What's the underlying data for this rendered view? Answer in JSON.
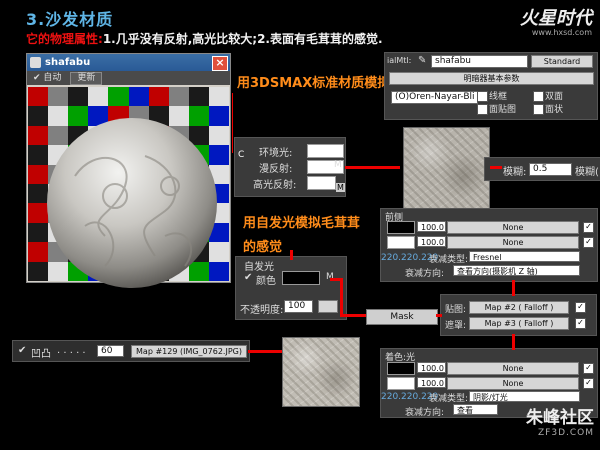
{
  "header": {
    "title": "3.沙发材质",
    "subtitle_red": "它的物理属性:",
    "subtitle_white": "1.几乎没有反射,高光比较大;2.表面有毛茸茸的感觉.",
    "brand": "火星时代",
    "brand_url": "www.hxsd.com"
  },
  "viewer": {
    "title": "shafabu",
    "auto_label": "自动",
    "update_label": "更新",
    "checker_colors": [
      "#c00000",
      "#0018c0",
      "#00a000",
      "#e0e0e0",
      "#1a1a1a",
      "#808080"
    ]
  },
  "notes": {
    "standard_note": "用3DSMAX标准材质模拟:",
    "fuzz_note_1": "用自发光模拟毛茸茸",
    "fuzz_note_2": "的感觉"
  },
  "material_header": {
    "label": "ialMtl:",
    "name": "shafabu",
    "type": "Standard",
    "rollout": "明暗器基本参数",
    "shader": "(O)Oren-Nayar-Bli",
    "opts": [
      "线框",
      "双面",
      "面贴图",
      "面状"
    ]
  },
  "color_panel": {
    "ambient": "环境光:",
    "diffuse": "漫反射:",
    "specular": "高光反射:",
    "lock": "C",
    "m": "M"
  },
  "blur": {
    "label": "模糊:",
    "value": "0.5",
    "label2": "模糊("
  },
  "front_side": {
    "header": "前侧",
    "a_value": "100.0",
    "b_value": "100.0",
    "map_a": "None",
    "map_b": "None",
    "falloff_type_label": "衰减类型:",
    "falloff_type": "Fresnel",
    "falloff_dir_label": "衰减方向:",
    "falloff_dir": "查看方向(摄影机 Z 轴)",
    "rgb": "220.220.220"
  },
  "self_illum": {
    "header": "自发光",
    "color_label": "颜色",
    "m": "M",
    "opacity_label": "不透明度:",
    "opacity": "100"
  },
  "mask": {
    "label": "Mask",
    "map_label": "贴图:",
    "map": "Map #2 ( Falloff )",
    "mask_label": "遮罩:",
    "mask_map": "Map #3 ( Falloff )"
  },
  "bump": {
    "label": "凹凸",
    "dots": ". . . . .",
    "value": "60",
    "map": "Map #129 (IMG_0762.JPG)"
  },
  "shade": {
    "header": "着色:光",
    "a_value": "100.0",
    "b_value": "100.0",
    "map_a": "None",
    "map_b": "None",
    "falloff_type_label": "衰减类型:",
    "falloff_type": "阴影/灯光",
    "falloff_dir_label": "衰减方向:",
    "falloff_dir": "查看",
    "rgb": "220.220.220"
  },
  "watermark": {
    "text": "朱峰社区",
    "url": "ZF3D.COM"
  }
}
